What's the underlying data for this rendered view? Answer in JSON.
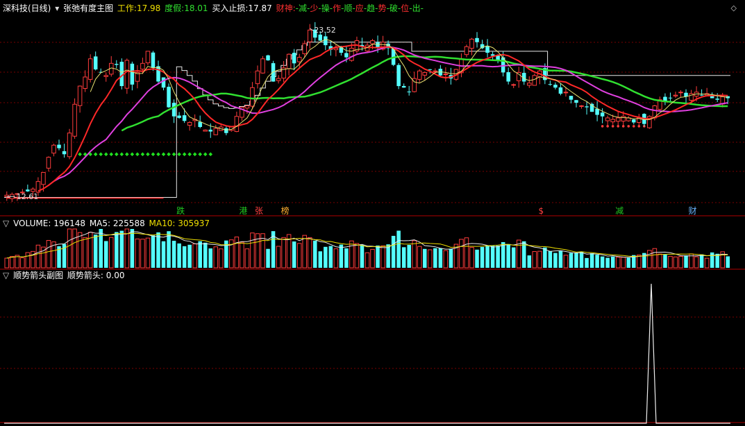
{
  "main_header": {
    "stock_name": "深科技(日线)",
    "indicator_name": "张弛有度主图",
    "work_label": "工作:",
    "work_value": "17.98",
    "fake_label": "度假:",
    "fake_value": "18.01",
    "stop_label": "买入止损:",
    "stop_value": "17.87",
    "god_label": "财神:",
    "signal_chars": [
      "减",
      "少",
      "操",
      "作",
      "顺",
      "应",
      "趋",
      "势",
      "破",
      "位",
      "出"
    ],
    "signal_sep": "-",
    "collapse_icon": "diamond-icon"
  },
  "volume_header": {
    "label": "VOLUME:",
    "value": "196148",
    "ma5_label": "MA5:",
    "ma5_value": "225588",
    "ma10_label": "MA10:",
    "ma10_value": "305937"
  },
  "arrow_header": {
    "indicator_name": "顺势箭头副图",
    "label": "顺势箭头:",
    "value": "0.00"
  },
  "annotations": {
    "high_label": "23.52",
    "low_label": "12.61",
    "markers": [
      {
        "text": "跌",
        "color": "#21c821"
      },
      {
        "text": "港",
        "color": "#21c821"
      },
      {
        "text": "张",
        "color": "#ff4040"
      },
      {
        "text": "榜",
        "color": "#ffb030"
      },
      {
        "text": "$",
        "color": "#ff4040"
      },
      {
        "text": "减",
        "color": "#21c821"
      },
      {
        "text": "财",
        "color": "#6ab4ff"
      }
    ]
  },
  "colors": {
    "up": "#ff3c3c",
    "down": "#54ffff",
    "ma_red": "#ff2828",
    "ma_magenta": "#e040e0",
    "ma_green": "#30e030",
    "ma_yellow": "#e8e070",
    "grid": "#7a0000",
    "step_line": "#e8e8e8",
    "green_dots": "#20e020"
  },
  "chart_data": [
    {
      "type": "candlestick",
      "title": "张弛有度主图",
      "ylim": [
        12.3,
        24.3
      ],
      "close": [
        12.7,
        12.75,
        12.8,
        12.9,
        12.95,
        13.1,
        13.6,
        14.2,
        15.2,
        16.0,
        15.8,
        15.4,
        16.8,
        18.7,
        19.9,
        20.5,
        21.7,
        21.0,
        20.8,
        20.6,
        21.4,
        21.3,
        19.9,
        21.6,
        20.0,
        20.8,
        21.4,
        22.2,
        21.1,
        20.2,
        19.8,
        18.5,
        17.9,
        17.8,
        17.6,
        17.5,
        17.7,
        17.2,
        17.0,
        16.9,
        17.1,
        17.2,
        16.8,
        17.2,
        17.9,
        18.5,
        18.6,
        19.8,
        20.9,
        21.7,
        21.6,
        20.2,
        20.4,
        21.1,
        22.0,
        21.4,
        21.8,
        22.7,
        23.6,
        23.1,
        22.9,
        22.6,
        22.3,
        22.4,
        22.1,
        21.8,
        22.4,
        22.9,
        22.5,
        22.6,
        22.9,
        22.4,
        22.8,
        22.4,
        21.3,
        19.9,
        19.8,
        19.5,
        20.4,
        20.9,
        20.8,
        21.0,
        20.9,
        20.6,
        20.7,
        20.4,
        21.0,
        21.7,
        22.5,
        23.0,
        22.8,
        22.4,
        22.1,
        21.9,
        21.6,
        20.8,
        20.2,
        20.0,
        20.8,
        20.2,
        20.1,
        20.6,
        20.9,
        20.3,
        20.0,
        19.8,
        19.4,
        19.5,
        19.0,
        18.8,
        18.6,
        18.5,
        18.2,
        18.0,
        17.9,
        17.8,
        17.7,
        17.8,
        17.9,
        17.8,
        17.5,
        17.8,
        17.4,
        17.9,
        18.6,
        19.0,
        18.9,
        19.1,
        19.3,
        19.5,
        19.2,
        19.4,
        19.5,
        19.3,
        19.4,
        19.1,
        19.0,
        19.2,
        19.1
      ]
    },
    {
      "type": "bar",
      "title": "VOLUME",
      "series": [
        {
          "name": "VOLUME"
        },
        {
          "name": "MA5"
        },
        {
          "name": "MA10"
        }
      ]
    },
    {
      "type": "line",
      "title": "顺势箭头副图",
      "series": [
        {
          "name": "顺势箭头"
        }
      ]
    }
  ]
}
